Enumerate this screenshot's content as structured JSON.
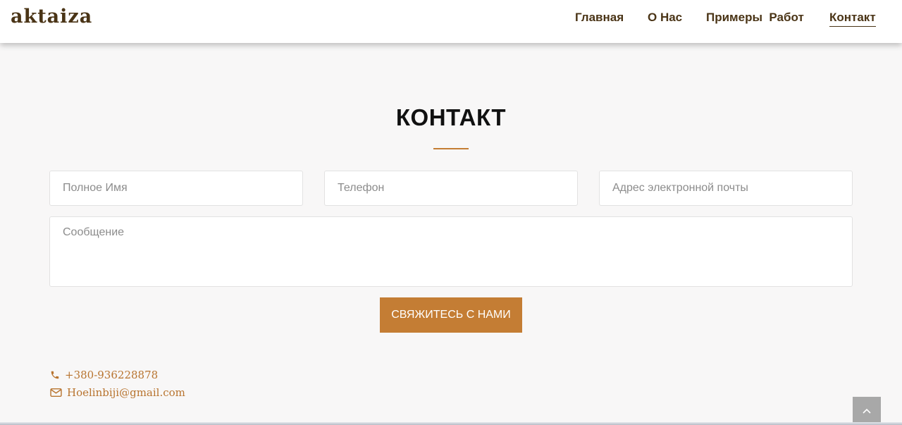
{
  "header": {
    "logo": "aktaiza",
    "nav": [
      {
        "label": "Главная"
      },
      {
        "label": "О Нас"
      },
      {
        "label": "Примеры  Работ"
      },
      {
        "label": "Контакт",
        "active": true
      }
    ]
  },
  "contact": {
    "title": "КОНТАКТ",
    "form": {
      "name_placeholder": "Полное Имя",
      "phone_placeholder": "Телефон",
      "email_placeholder": "Адрес электронной почты",
      "message_placeholder": "Сообщение",
      "submit_label": "СВЯЖИТЕСЬ С НАМИ"
    },
    "info": {
      "phone": "+380-936228878",
      "email": "Hoelinbiji@gmail.com"
    }
  },
  "colors": {
    "accent": "#c47d34",
    "brand_text": "#4a3416",
    "background": "#f8f7f7"
  },
  "icons": {
    "phone": "phone-icon",
    "email": "envelope-icon",
    "scroll_top": "chevron-up-icon"
  }
}
